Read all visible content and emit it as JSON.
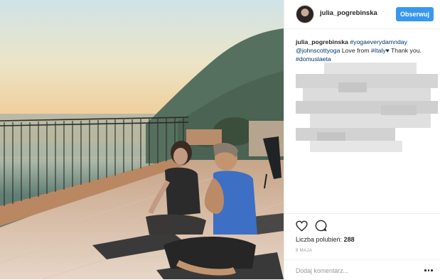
{
  "post": {
    "username": "julia_pogrebinska",
    "follow_label": "Obserwuj",
    "caption": {
      "user": "julia_pogrebinska",
      "hashtag1": "#yogaeverydamnday",
      "mention": "@johnscottyoga",
      "text1": " Love from ",
      "hashtag2": "#Italy",
      "heart": "♥",
      "text2": " Thank you. ",
      "hashtag3": "#domuslaeta"
    },
    "likes_label": "Liczba polubień:",
    "likes_count": "288",
    "date": "9 MAJA",
    "comment_placeholder": "Dodaj komentarz..."
  },
  "icons": {
    "avatar": "avatar-photo",
    "like": "heart-outline-icon",
    "comment": "comment-bubble-icon",
    "more": "more-options-icon"
  },
  "colors": {
    "follow_button": "#3897f0",
    "link": "#003569",
    "text": "#262626",
    "muted": "#999999"
  }
}
